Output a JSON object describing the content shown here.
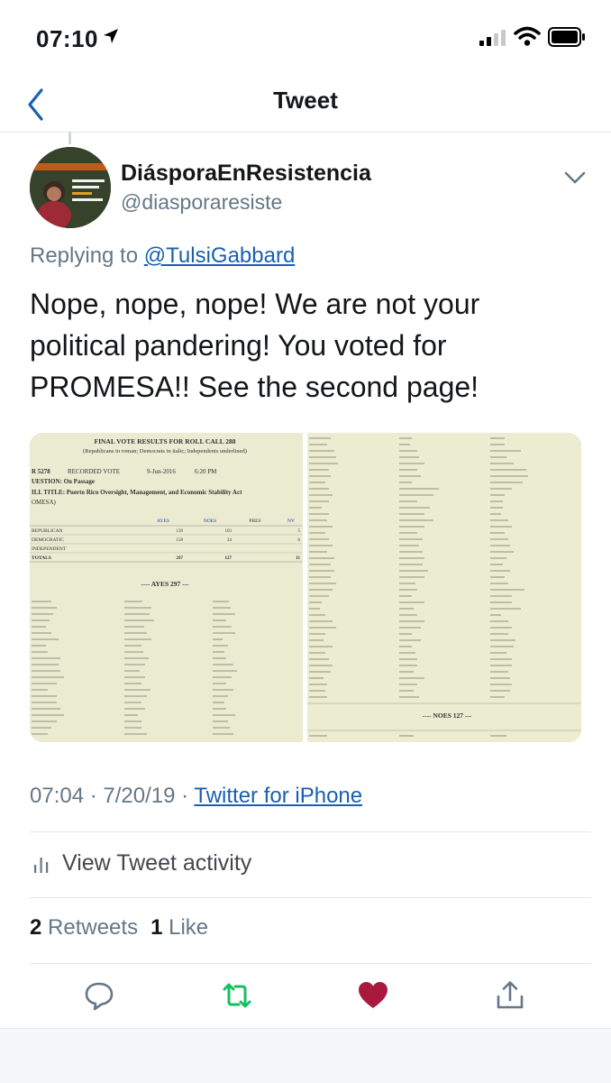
{
  "status_bar": {
    "time": "07:10"
  },
  "nav": {
    "title": "Tweet"
  },
  "tweet": {
    "author_name": "DiásporaEnResistencia",
    "author_handle": "@diasporaresiste",
    "reply_prefix": "Replying to",
    "reply_to": "@TulsiGabbard",
    "text": "Nope, nope, nope! We are not your political pandering! You voted for PROMESA!! See the second page!",
    "timestamp": "07:04 · 7/20/19 ·",
    "source": "Twitter for iPhone"
  },
  "media": {
    "doc1": {
      "title": "FINAL VOTE RESULTS FOR ROLL CALL 288",
      "subtitle": "(Republicans in roman; Democrats in italic; Independents underlined)",
      "bill": "R 5278",
      "recorded_vote": "RECORDED VOTE",
      "date": "9-Jun-2016",
      "time": "6:20 PM",
      "question": "UESTION: On Passage",
      "bill_title": "ILL TITLE: Puerto Rico Oversight, Management, and Economic Stability Act",
      "bill_title_2": "OMESA)",
      "headers": [
        "AYES",
        "NOES",
        "PRES",
        "NV"
      ],
      "rows": [
        {
          "label": "REPUBLICAN",
          "values": [
            "139",
            "103",
            "",
            "5"
          ]
        },
        {
          "label": "DEMOCRATIC",
          "values": [
            "158",
            "24",
            "",
            "6"
          ]
        },
        {
          "label": "INDEPENDENT",
          "values": [
            "",
            "",
            "",
            ""
          ]
        },
        {
          "label": "TOTALS",
          "values": [
            "297",
            "127",
            "",
            "11"
          ]
        }
      ],
      "ayes_header": "---- AYES   297 ---"
    },
    "doc2": {
      "noes_header": "---- NOES   127 ---"
    }
  },
  "activity": {
    "label": "View Tweet activity"
  },
  "stats": {
    "retweets_count": "2",
    "retweets_label": "Retweets",
    "likes_count": "1",
    "likes_label": "Like"
  },
  "colors": {
    "link": "#1b5fb0",
    "retweet": "#17bf63",
    "like": "#a8193d",
    "secondary": "#657786"
  }
}
